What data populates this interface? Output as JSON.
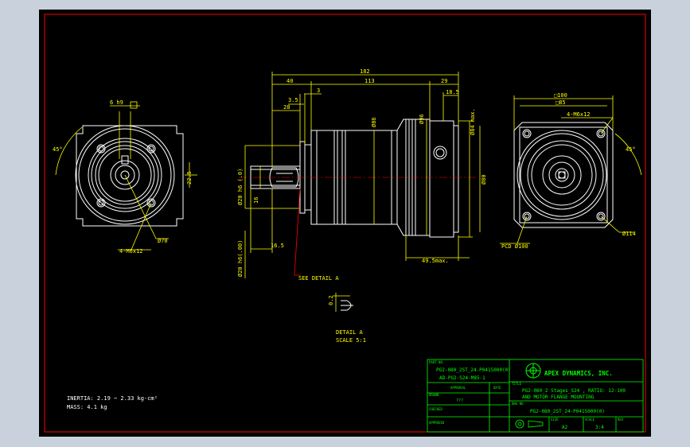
{
  "colors": {
    "background": "#000000",
    "frame": "#ff0000",
    "geometry": "#ffffff",
    "dimensions": "#ffff00",
    "titleblock": "#00ff00",
    "leader": "#ff0000"
  },
  "dimensions": {
    "overall": "182",
    "d40": "40",
    "d113": "113",
    "d29": "29",
    "d35": "3.5",
    "d28": "28",
    "d185": "18.5",
    "d3": "3",
    "key_width": "6 h9",
    "d165": "16.5",
    "d495": "49.5max.",
    "d86": "Ø86",
    "d96": "Ø96",
    "d84": "Ø84 max.",
    "d80": "Ø80",
    "shaft_dia": "Ø20 h6 (.0)",
    "shaft_dia2": "Ø20 h6(.00)",
    "d16": "16",
    "d225": "22.5",
    "angle_left": "45°",
    "angle_right": "45°",
    "d70": "Ø70",
    "thread_left": "4-M6x12",
    "thread_right": "4-M6x12",
    "sq100": "□100",
    "sq85": "□85",
    "d114": "Ø114",
    "pcd": "PCD Ø100",
    "detail_call": "SEE DETAIL A",
    "detail_a_dim": "0.2",
    "detail_a_title": "DETAIL A",
    "detail_a_scale": "SCALE 5:1"
  },
  "notes": {
    "inertia": "INERTIA: 2.19 ~ 2.33 kg-cm²",
    "mass": "MASS: 4.1 kg"
  },
  "titleblock": {
    "part_no_label": "PART NO.",
    "part_no_1": "PG2-080_2ST_24-P0415000(0)",
    "part_no_2": "AD-PG2-S24-M85-1",
    "company": "APEX DYNAMICS, INC.",
    "approval_label": "APPROVAL",
    "date_label": "DATE",
    "title_label": "TITLE",
    "title_1": "PG2-080_2 Stages_S24 , RATIO: 12-100",
    "title_2": "AND MOTOR FLANGE MOUNTING",
    "drawn_label": "DRAWN",
    "drawn_value": "???",
    "dwg_no_label": "DWG NO.",
    "dwg_no": "PG2-080_2ST_24-P0415000(0)",
    "checked_label": "CHECKED",
    "size_label": "SIZE",
    "size_value": "A2",
    "scale_label": "SCALE",
    "scale_value": "3:4",
    "rev_label": "REV",
    "approved_label": "APPROVED"
  }
}
